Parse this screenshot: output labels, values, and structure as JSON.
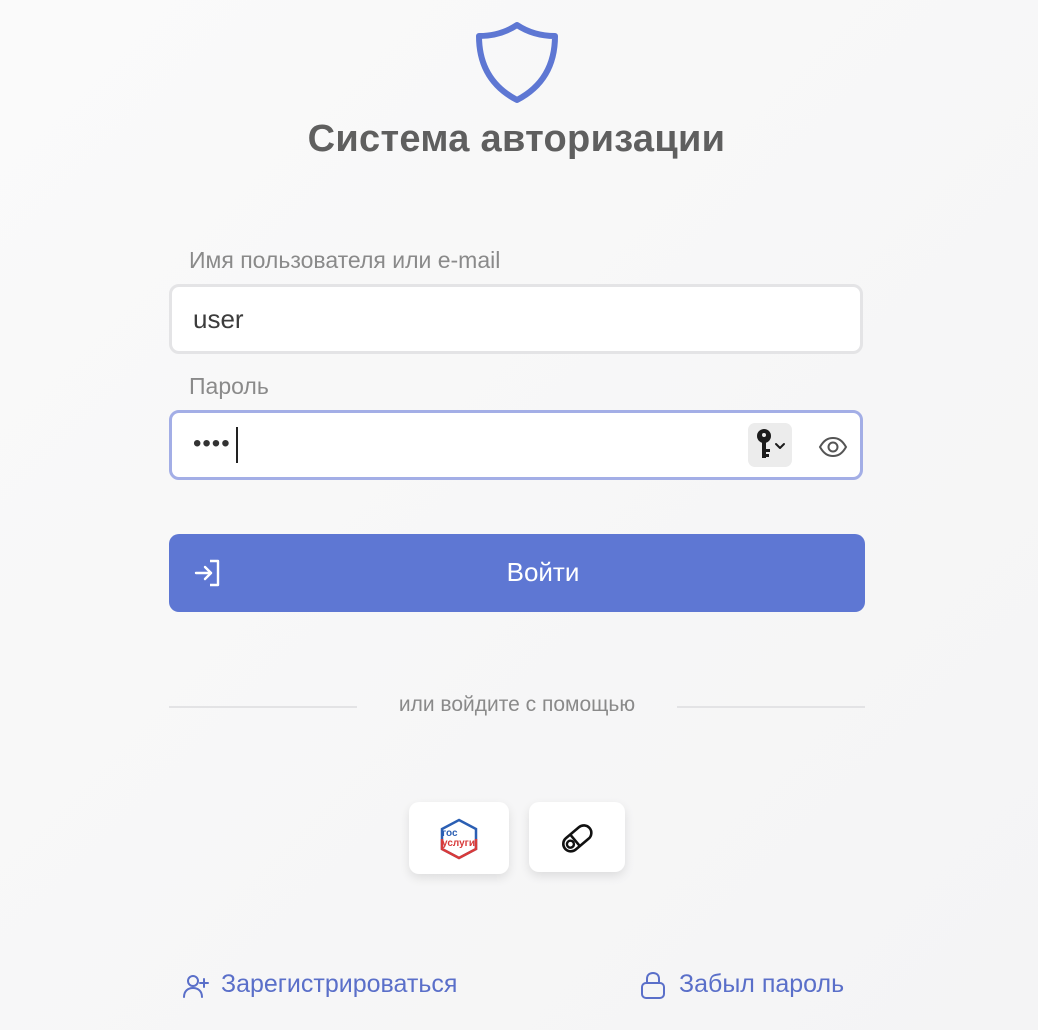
{
  "app": {
    "title": "Система авторизации",
    "accent_color": "#5e77d3"
  },
  "username_field": {
    "label": "Имя пользователя или e-mail",
    "value": "user"
  },
  "password_field": {
    "label": "Пароль",
    "masked_value": "••••",
    "key_icon": "key-icon",
    "visibility_icon": "eye-icon"
  },
  "login_button": {
    "label": "Войти",
    "icon": "sign-in-icon"
  },
  "alt_login": {
    "divider_text": "или войдите с помощью",
    "options": [
      {
        "name": "gosuslugi",
        "line1": "гос",
        "line2": "услуги"
      },
      {
        "name": "usb-token",
        "icon": "usb-key-icon"
      }
    ]
  },
  "footer_links": {
    "register": "Зарегистрироваться",
    "forgot_password": "Забыл пароль"
  }
}
